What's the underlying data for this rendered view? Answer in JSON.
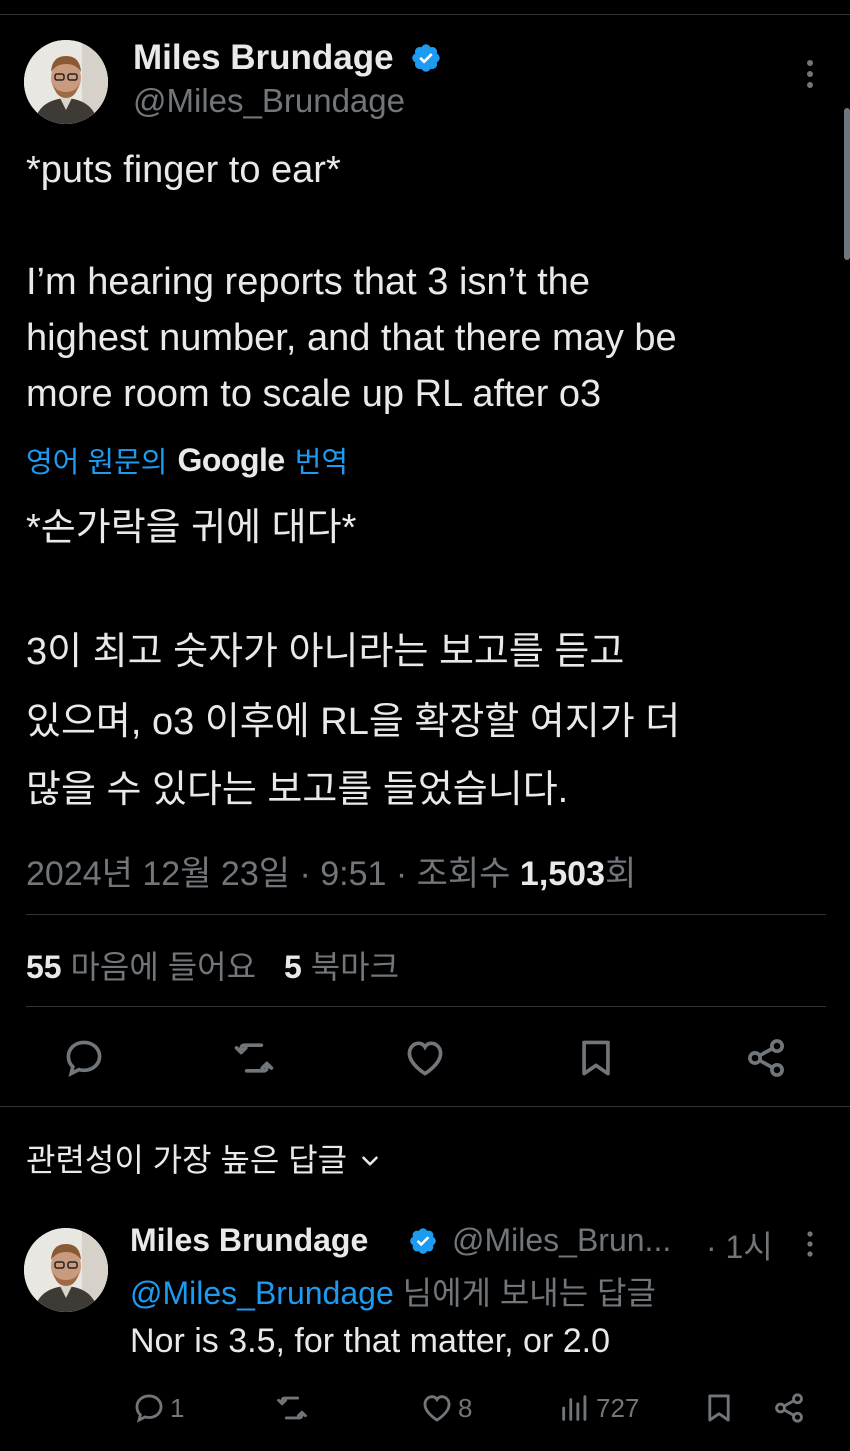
{
  "tweet": {
    "author_name": "Miles Brundage",
    "author_handle": "@Miles_Brundage",
    "text_line1": "*puts finger to ear*",
    "text_para2_l1": "I’m hearing reports that 3 isn’t the",
    "text_para2_l2": "highest number, and that there may be",
    "text_para2_l3": "more room to scale up RL after o3",
    "translate_prefix": "영어 원문의",
    "translate_brand": "Google",
    "translate_suffix": "번역",
    "translated_line1": "*손가락을 귀에 대다*",
    "translated_p2_l1": "3이 최고 숫자가 아니라는 보고를 듣고",
    "translated_p2_l2": "있으며, o3 이후에 RL을 확장할 여지가 더",
    "translated_p2_l3": "많을 수 있다는 보고를 들었습니다.",
    "date_time": "2024년 12월 23일 · 9:51 · 조회수",
    "views_count": "1,503",
    "views_suffix": "회",
    "likes_count": "55",
    "likes_label": "마음에 들어요",
    "bookmarks_count": "5",
    "bookmarks_label": "북마크"
  },
  "replies_section": {
    "sort_label": "관련성이 가장 높은 답글"
  },
  "reply": {
    "author_name": "Miles Brundage",
    "author_handle": "@Miles_Brun...",
    "time": "· 1시",
    "replying_to_mention": "@Miles_Brundage",
    "replying_to_suffix": "님에게 보내는 답글",
    "text": "Nor is 3.5, for that matter, or 2.0",
    "reply_count": "1",
    "like_count": "8",
    "view_count": "727"
  },
  "colors": {
    "background": "#000000",
    "text": "#e7e9ea",
    "muted": "#71767b",
    "accent": "#1d9bf0",
    "divider": "#2f3336"
  },
  "icons": [
    "verified-badge-icon",
    "more-icon",
    "reply-icon",
    "retweet-icon",
    "like-icon",
    "bookmark-icon",
    "share-icon",
    "chevron-down-icon",
    "views-icon"
  ]
}
